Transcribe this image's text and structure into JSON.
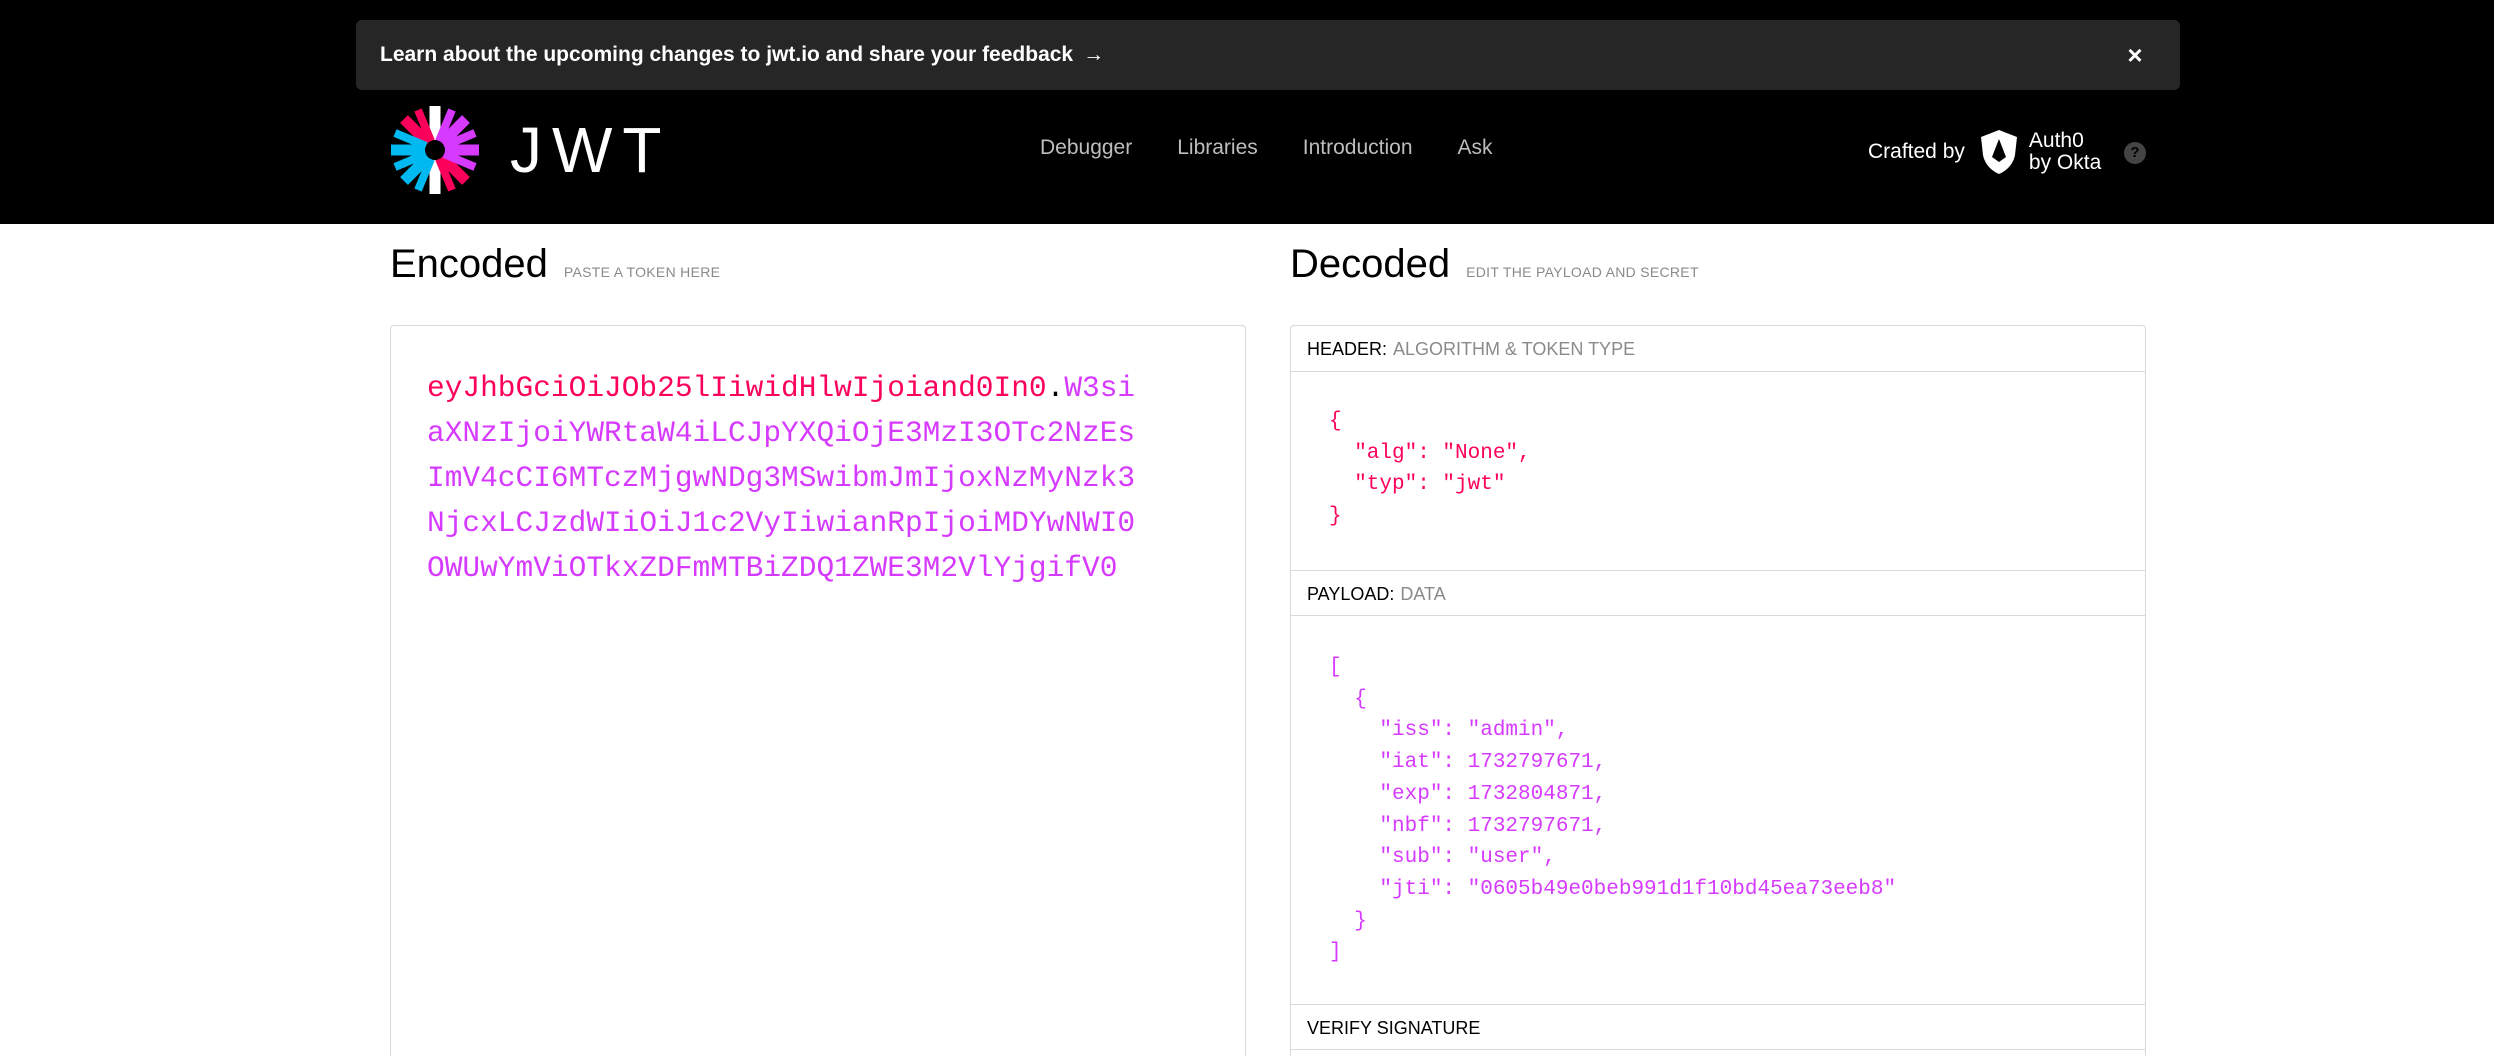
{
  "banner": {
    "text": "Learn about the upcoming changes to jwt.io and share your feedback",
    "arrow": "→",
    "close": "×"
  },
  "brand": {
    "logo_text": "JWT"
  },
  "nav": {
    "items": [
      "Debugger",
      "Libraries",
      "Introduction",
      "Ask"
    ]
  },
  "crafted": {
    "label": "Crafted by",
    "company_line1": "Auth0",
    "company_line2": "by Okta",
    "help": "?"
  },
  "encoded": {
    "title": "Encoded",
    "subtitle": "PASTE A TOKEN HERE",
    "token_header": "eyJhbGciOiJOb25lIiwidHlwIjoiand0In0",
    "token_dot": ".",
    "token_payload": "W3siaXNzIjoiYWRtaW4iLCJpYXQiOjE3MzI3OTc2NzEsImV4cCI6MTczMjgwNDg3MSwibmJmIjoxNzMyNzk3NjcxLCJzdWIiOiJ1c2VyIiwianRpIjoiMDYwNWI0OWUwYmViOTkxZDFmMTBiZDQ1ZWE3M2VlYjgifV0"
  },
  "decoded": {
    "title": "Decoded",
    "subtitle": "EDIT THE PAYLOAD AND SECRET",
    "header_label": "HEADER:",
    "header_hint": "ALGORITHM & TOKEN TYPE",
    "header_json": "{\n  \"alg\": \"None\",\n  \"typ\": \"jwt\"\n}",
    "payload_label": "PAYLOAD:",
    "payload_hint": "DATA",
    "payload_json": "[\n  {\n    \"iss\": \"admin\",\n    \"iat\": 1732797671,\n    \"exp\": 1732804871,\n    \"nbf\": 1732797671,\n    \"sub\": \"user\",\n    \"jti\": \"0605b49e0beb991d1f10bd45ea73eeb8\"\n  }\n]",
    "verify_label": "VERIFY SIGNATURE"
  },
  "colors": {
    "header": "#fb015b",
    "payload": "#d63aff",
    "logo_cyan": "#00b9f1",
    "logo_pink": "#fb015b",
    "logo_purple": "#d63aff"
  }
}
